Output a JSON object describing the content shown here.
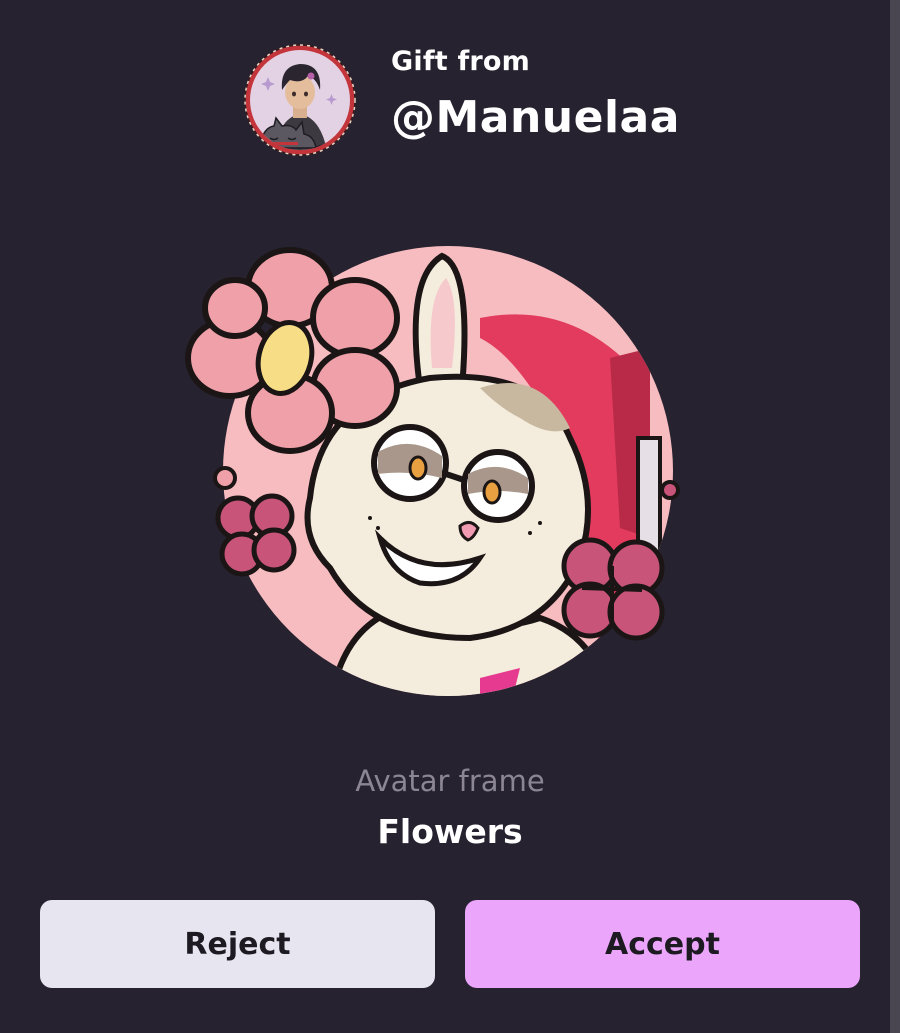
{
  "gift": {
    "from_label": "Gift from",
    "username": "@Manuelaa"
  },
  "item": {
    "type": "Avatar frame",
    "name": "Flowers"
  },
  "actions": {
    "reject_label": "Reject",
    "accept_label": "Accept"
  },
  "colors": {
    "background": "#27222f",
    "accept": "#eba6fc",
    "reject": "#e7e5f0",
    "frame_ring": "#c4343b",
    "flower_pink": "#f0a0a8",
    "clover_pink": "#c9547a"
  }
}
